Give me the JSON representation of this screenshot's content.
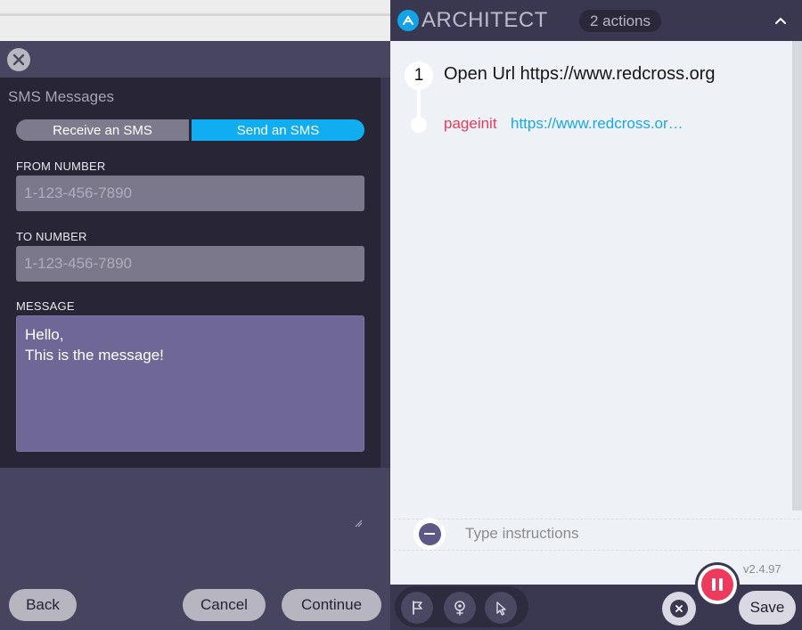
{
  "sms_modal": {
    "section_title": "SMS Messages",
    "tabs": [
      {
        "label": "Receive an SMS",
        "active": false
      },
      {
        "label": "Send an SMS",
        "active": true
      }
    ],
    "from_number": {
      "label": "FROM NUMBER",
      "placeholder": "1-123-456-7890",
      "value": ""
    },
    "to_number": {
      "label": "TO NUMBER",
      "placeholder": "1-123-456-7890",
      "value": ""
    },
    "message": {
      "label": "MESSAGE",
      "value": "Hello,\nThis is the message!"
    },
    "footer": {
      "back_label": "Back",
      "cancel_label": "Cancel",
      "continue_label": "Continue"
    }
  },
  "architect": {
    "brand": "ARCHITECT",
    "actions_badge": "2 actions",
    "steps": [
      {
        "number": "1",
        "title": "Open Url https://www.redcross.org",
        "event_type": "pageinit",
        "event_url": "https://www.redcross.or…"
      }
    ],
    "instructions_placeholder": "Type instructions",
    "version": "v2.4.97",
    "save_label": "Save"
  },
  "colors": {
    "accent_blue": "#10adf0",
    "record_red": "#ee3a5c",
    "event_type_red": "#e83a5c",
    "link_blue": "#1aa7e6",
    "panel_dark": "#3a3850",
    "modal_dark": "#272536",
    "textarea_purple": "#6f6795"
  },
  "icons": {
    "modal_close": "close-icon",
    "logo": "architect-logo-icon",
    "collapse": "chevron-up-icon",
    "remove_instruction": "minus-icon",
    "tool_flag": "flag-icon",
    "tool_watch": "eye-pin-icon",
    "tool_pointer": "pointer-click-icon",
    "cancel_recording": "close-icon",
    "pause_recording": "pause-icon"
  }
}
